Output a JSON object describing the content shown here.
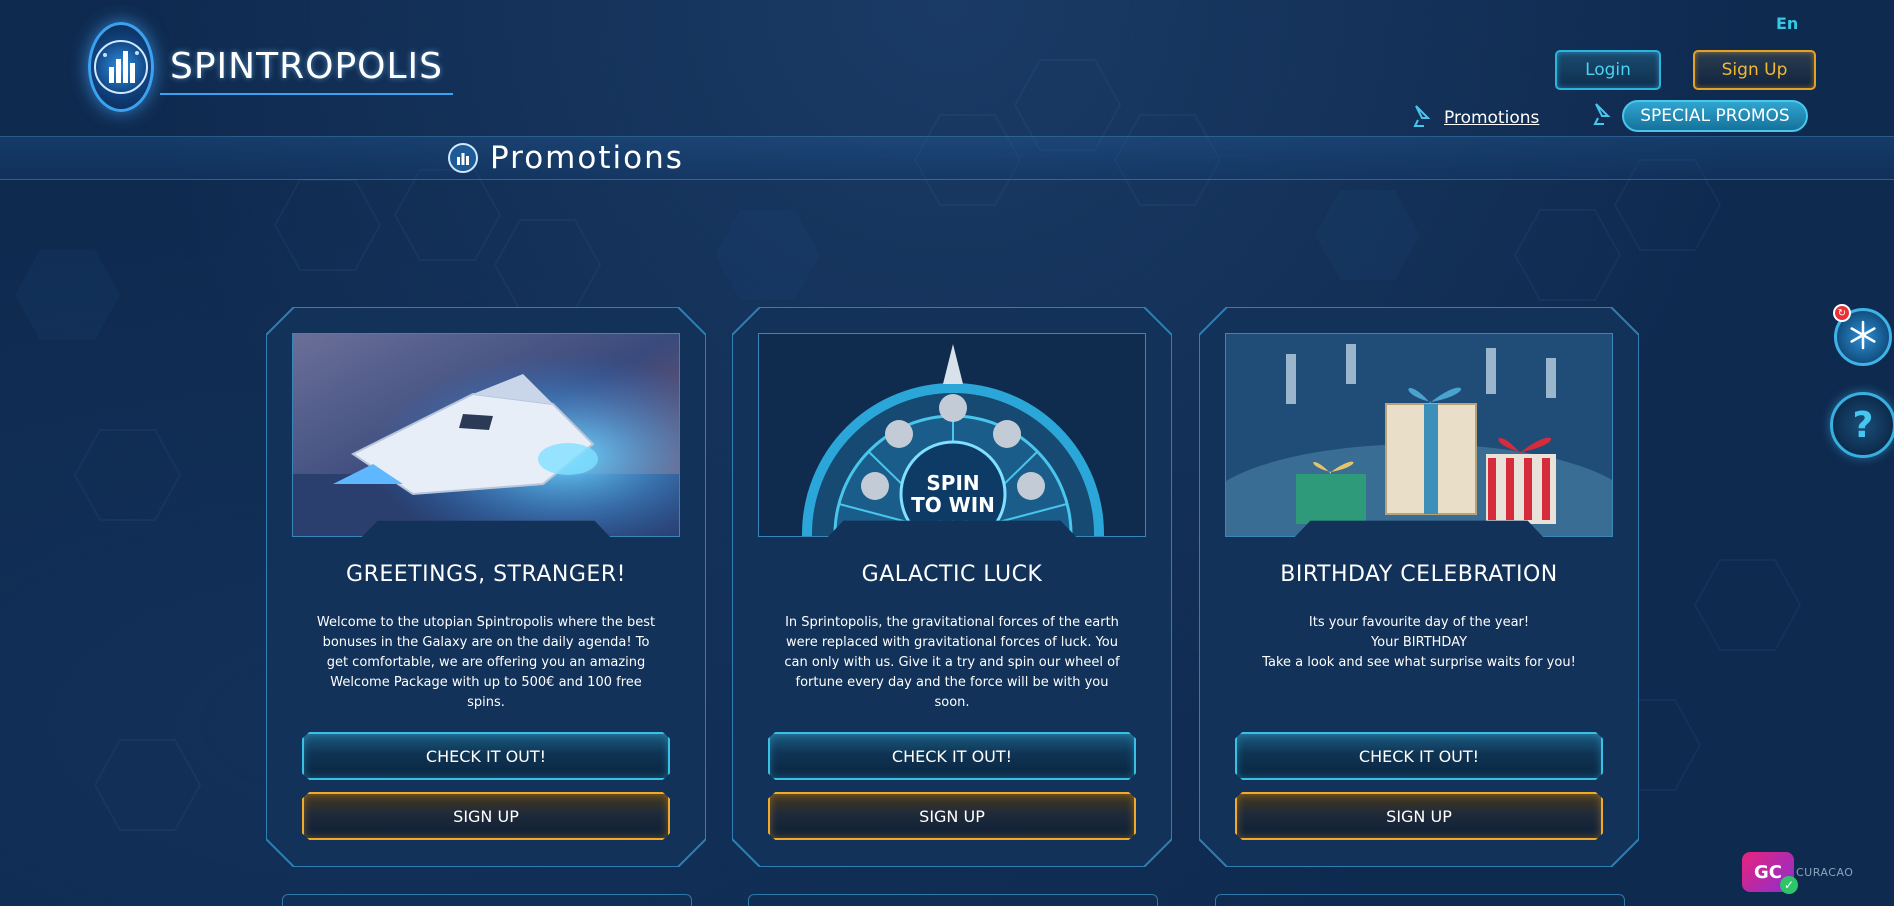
{
  "brand": {
    "name": "SPINTROPOLIS"
  },
  "header": {
    "language": "En",
    "login_label": "Login",
    "signup_label": "Sign Up",
    "nav_promotions": "Promotions",
    "nav_special_promos": "SPECIAL PROMOS"
  },
  "page": {
    "title": "Promotions"
  },
  "cards": [
    {
      "title": "GREETINGS, STRANGER!",
      "description": "Welcome to the utopian Spintropolis where the best bonuses in the Galaxy are on the daily agenda! To get comfortable, we are offering you an amazing Welcome Package with up to 500€ and 100 free spins.",
      "check_label": "CHECK IT OUT!",
      "signup_label": "SIGN UP"
    },
    {
      "title": "GALACTIC LUCK",
      "description": "In Sprintopolis, the gravitational forces of the earth were replaced with gravitational forces of luck. You can only with us. Give it a try and spin our wheel of fortune every day and the force will be with you soon.",
      "check_label": "CHECK IT OUT!",
      "signup_label": "SIGN UP",
      "image_text": "SPIN\nTO WIN"
    },
    {
      "title": "BIRTHDAY CELEBRATION",
      "description": "Its your favourite day of the year!\nYour BIRTHDAY\nTake a look and see what surprise waits for you!",
      "check_label": "CHECK IT OUT!",
      "signup_label": "SIGN UP"
    }
  ],
  "side": {
    "help_symbol": "?"
  },
  "footer_badge": {
    "mark": "GC",
    "text": "CURACAO"
  },
  "colors": {
    "background": "#0f2a4f",
    "accent_cyan": "#38c0e6",
    "accent_gold": "#f0a92a",
    "special_pill": "#1f8cb8"
  },
  "icons": [
    "logo-emblem",
    "satellite-icon",
    "snowflake-icon",
    "help-icon",
    "gift-icon"
  ]
}
